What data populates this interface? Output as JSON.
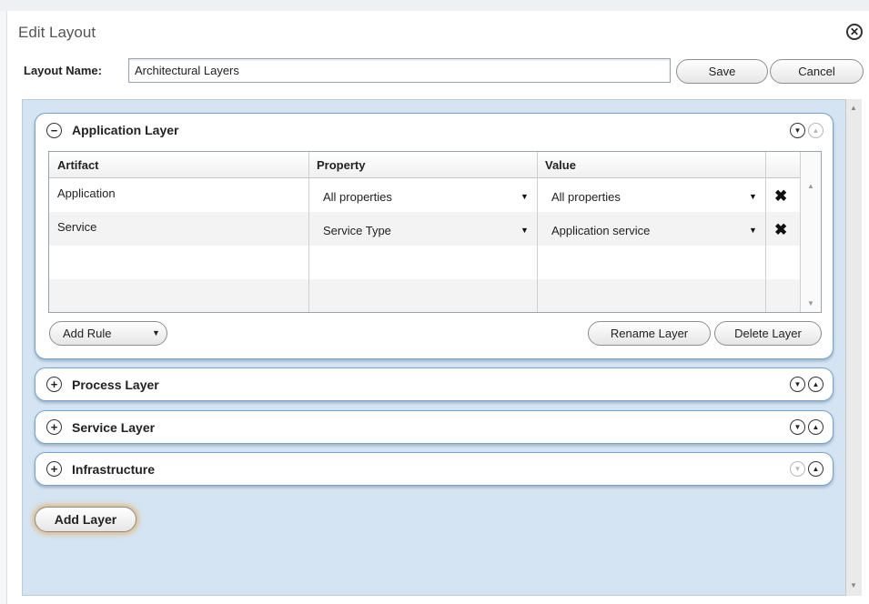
{
  "dialog": {
    "title": "Edit Layout"
  },
  "layout_name": {
    "label": "Layout Name:",
    "value": "Architectural Layers"
  },
  "buttons": {
    "save": "Save",
    "cancel": "Cancel",
    "add_layer": "Add Layer"
  },
  "application_layer": {
    "title": "Application Layer",
    "expanded": true,
    "columns": [
      "Artifact",
      "Property",
      "Value"
    ],
    "rows": [
      {
        "artifact": "Application",
        "property": "All properties",
        "value": "All properties"
      },
      {
        "artifact": "Service",
        "property": "Service Type",
        "value": "Application service"
      }
    ],
    "add_rule": "Add Rule",
    "rename": "Rename Layer",
    "delete": "Delete Layer"
  },
  "layers": [
    {
      "title": "Process Layer"
    },
    {
      "title": "Service Layer"
    },
    {
      "title": "Infrastructure"
    }
  ],
  "icons": {
    "close": "close-circle-icon",
    "collapse": "minus-circle-icon",
    "expand": "plus-circle-icon",
    "move_down": "arrow-down-circle-icon",
    "move_up": "arrow-up-circle-icon",
    "delete_rule": "x-icon",
    "dropdown": "caret-down-icon"
  },
  "colors": {
    "content_bg": "#d5e4f2",
    "panel_border": "#7aa2cc",
    "focus_glow": "#e8a03c"
  }
}
